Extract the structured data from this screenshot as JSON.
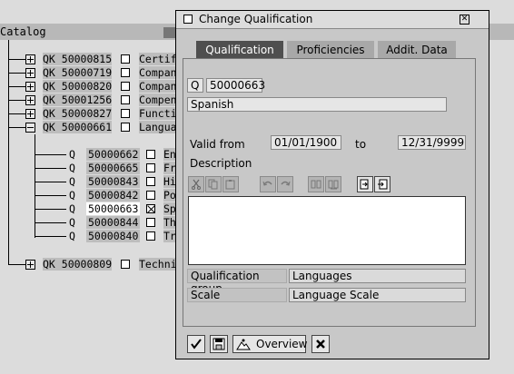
{
  "catalog": {
    "title": "Catalog",
    "items": [
      {
        "code": "QK 50000815",
        "label": "Certif",
        "expanded": false
      },
      {
        "code": "QK 50000719",
        "label": "Compan",
        "expanded": false
      },
      {
        "code": "QK 50000820",
        "label": "Compan",
        "expanded": false
      },
      {
        "code": "QK 50001256",
        "label": "Compen",
        "expanded": false
      },
      {
        "code": "QK 50000827",
        "label": "Functi",
        "expanded": false
      },
      {
        "code": "QK 50000661",
        "label": "Langua",
        "expanded": true
      }
    ],
    "children": [
      {
        "type": "Q",
        "id": "50000662",
        "label": "En",
        "checked": false
      },
      {
        "type": "Q",
        "id": "50000665",
        "label": "Fr",
        "checked": false
      },
      {
        "type": "Q",
        "id": "50000843",
        "label": "Hi",
        "checked": false
      },
      {
        "type": "Q",
        "id": "50000842",
        "label": "Po",
        "checked": false
      },
      {
        "type": "Q",
        "id": "50000663",
        "label": "Sp",
        "checked": true
      },
      {
        "type": "Q",
        "id": "50000844",
        "label": "Th",
        "checked": false
      },
      {
        "type": "Q",
        "id": "50000840",
        "label": "Tr",
        "checked": false
      }
    ],
    "last_item": {
      "code": "QK 50000809",
      "label": "Techni"
    }
  },
  "dialog": {
    "title": "Change Qualification",
    "tabs": [
      "Qualification",
      "Proficiencies",
      "Addit. Data"
    ],
    "object_type": "Q",
    "object_id": "50000663",
    "name": "Spanish",
    "valid_from_label": "Valid from",
    "valid_from": "01/01/1900",
    "to_label": "to",
    "valid_to": "12/31/9999",
    "description_label": "Description",
    "description_text": "",
    "qual_group_label": "Qualification group",
    "qual_group": "Languages",
    "scale_label": "Scale",
    "scale": "Language Scale",
    "overview_label": "Overview"
  }
}
